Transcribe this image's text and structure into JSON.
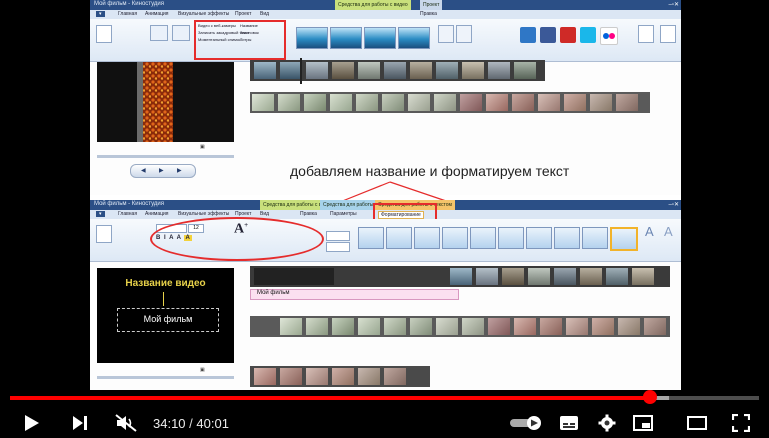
{
  "player": {
    "current_time": "34:10",
    "separator": " / ",
    "duration": "40:01",
    "progress": 0.854,
    "buffered": 0.88
  },
  "overlay_caption": "добавляем название и форматируем текст",
  "top_window": {
    "title": "Мой фильм - Киностудия",
    "contextual_tabs": [
      "Средства для работы с видео",
      "Проект"
    ],
    "tabs": [
      "Главная",
      "Анимация",
      "Визуальные эффекты",
      "Проект",
      "Вид",
      "Правка"
    ],
    "ribbon_items": [
      "Видео с веб-камеры",
      "Записать закадровый текст",
      "Моментальный снимок",
      "Название",
      "Заголовок",
      "Титры"
    ]
  },
  "bottom_window": {
    "title": "Мой фильм - Киностудия",
    "contextual_tabs": [
      "Средства для работы с видео",
      "Средства для работы с музыкой",
      "Средства для работы с текстом"
    ],
    "active_context_tab": "Форматирование",
    "tabs": [
      "Главная",
      "Анимация",
      "Визуальные эффекты",
      "Проект",
      "Вид",
      "Правка",
      "Параметры"
    ],
    "font_size": "12",
    "title_preview_text": "Название видео",
    "title_box_text": "Мой фильм",
    "timeline_text_label": "Мой фильм"
  },
  "colors": {
    "accent_red": "#ff0000",
    "highlight_red": "#e52c2c",
    "ribbon_blue": "#2b4f86"
  },
  "icons": [
    "play-icon",
    "next-icon",
    "muted-volume-icon",
    "autoplay-toggle-icon",
    "subtitles-icon",
    "settings-gear-icon",
    "miniplayer-icon",
    "theater-mode-icon",
    "fullscreen-icon"
  ]
}
